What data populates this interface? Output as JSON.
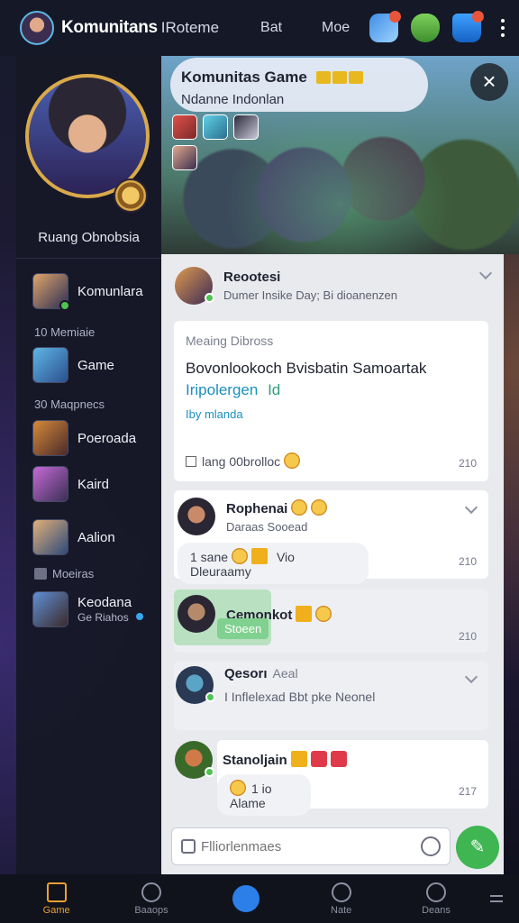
{
  "topbar": {
    "title": "Komunitans",
    "subtitle": "IRoteme",
    "links": [
      "Bat",
      "Moe"
    ]
  },
  "sidebar": {
    "room_label": "Ruang Obnobsia",
    "items": [
      {
        "label": "Komunlara",
        "online": true
      },
      {
        "label": "Game"
      },
      {
        "label": "Poeroada"
      },
      {
        "label": "Kaird"
      },
      {
        "label": "Aalion"
      },
      {
        "label": "Keodana",
        "sub": "Ge Riahos"
      }
    ],
    "meta": [
      "10 Memiaie",
      "30 Maqpnecs",
      "Moeiras"
    ]
  },
  "hero": {
    "title": "Komunitas Game",
    "subtitle": "Ndanne Indonlan",
    "close_icon": "×"
  },
  "chat": {
    "post": {
      "name": "Reootesi",
      "sub": "Dumer Insike Day; Bi dioanenzen",
      "card_label": "Meaing Dibross",
      "card_title": "Bovonlookoch Bvisbatin Samoartak",
      "card_link": "Iripolergen",
      "card_tag": "Id",
      "card_meta": "Iby mlanda",
      "card_footer": "lang 00brolloc",
      "time": "210"
    },
    "messages": [
      {
        "name": "Rophenai",
        "sub": "Daraas Sooead",
        "bubble": "1 sane",
        "bubble2": "Vio Dleuraamy",
        "time": "210"
      },
      {
        "name": "Cemonkot",
        "chip": "Stoeen",
        "time": "210"
      },
      {
        "name": "Qesorı",
        "name2": "Aeal",
        "sub": "I Inflelexad Bbt pke Neonel"
      },
      {
        "name": "Stanoljain",
        "bubble": "1 io Alame",
        "time": "217"
      }
    ]
  },
  "composer": {
    "placeholder": "Flliorlenmaes"
  },
  "bottomnav": [
    {
      "label": "Game",
      "active": true
    },
    {
      "label": "Baaops"
    },
    {
      "label": ""
    },
    {
      "label": "Nate"
    },
    {
      "label": "Deans"
    }
  ]
}
